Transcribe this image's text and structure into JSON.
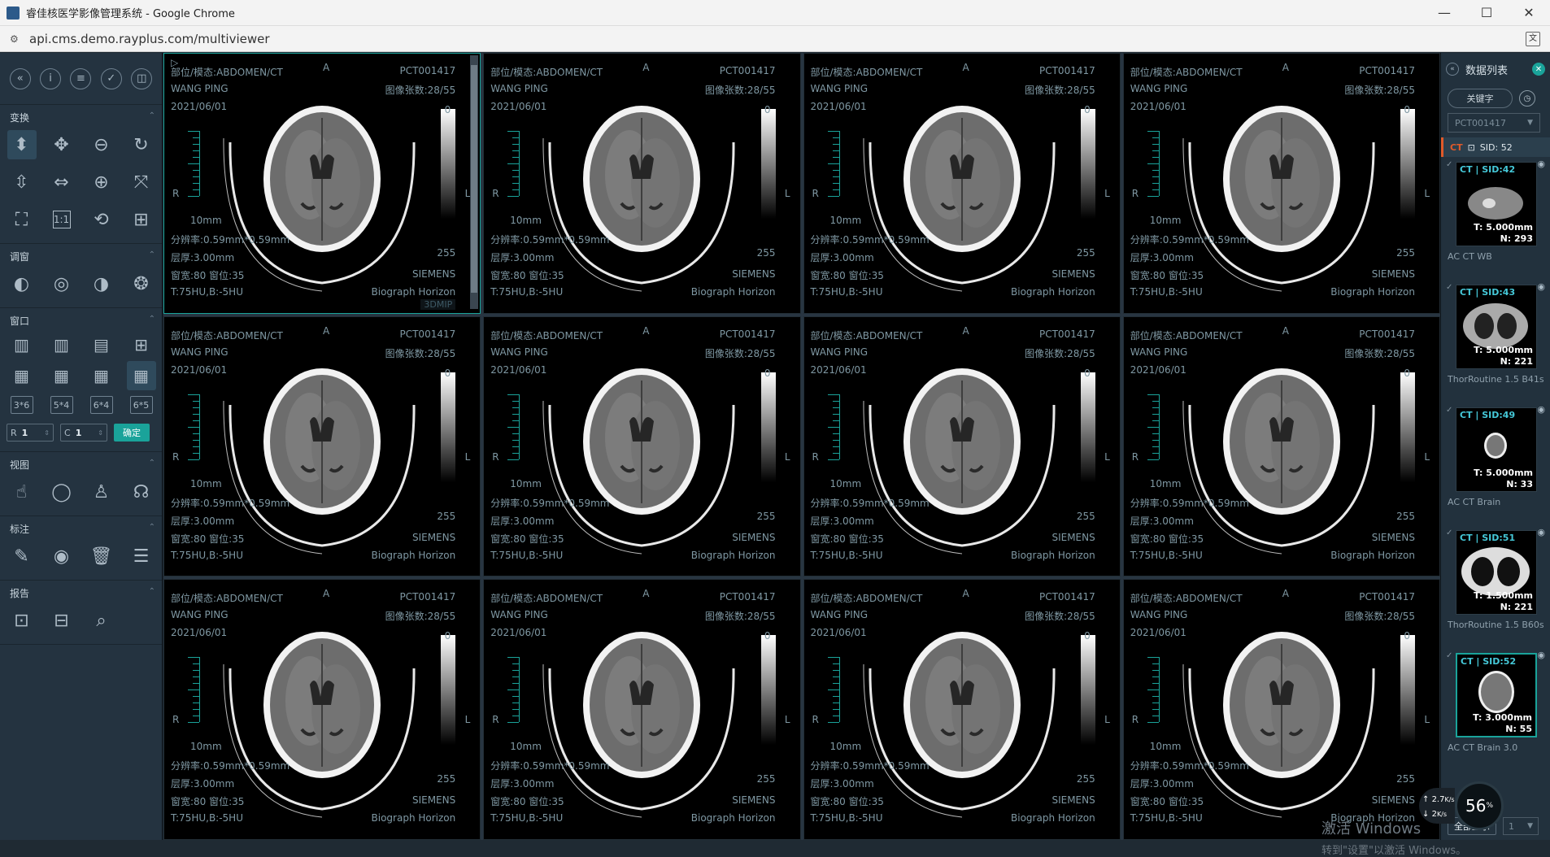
{
  "browser": {
    "title": "睿佳核医学影像管理系统 - Google Chrome",
    "url": "api.cms.demo.rayplus.com/multiviewer",
    "controls": [
      "—",
      "☐",
      "✕"
    ]
  },
  "left_panel": {
    "sections": [
      {
        "title": "变换"
      },
      {
        "title": "调窗"
      },
      {
        "title": "窗口"
      },
      {
        "title": "视图"
      },
      {
        "title": "标注"
      },
      {
        "title": "报告"
      }
    ],
    "layout_presets": [
      "3*6",
      "5*4",
      "6*4",
      "6*5"
    ],
    "row_label": "R",
    "row_value": "1",
    "col_label": "C",
    "col_value": "1",
    "confirm_label": "确定"
  },
  "viewport": {
    "body_part": "部位/模态:ABDOMEN/CT",
    "patient": "WANG PING",
    "date": "2021/06/01",
    "patient_id": "PCT001417",
    "image_count": "图像张数:28/55",
    "orient_top": "A",
    "orient_left": "R",
    "orient_right": "L",
    "scale_label": "10mm",
    "window_top": "0",
    "window_bottom": "255",
    "resolution": "分辨率:0.59mm*0.59mm",
    "thickness": "层厚:3.00mm",
    "window": "窗宽:80 窗位:35",
    "threshold": "T:75HU,B:-5HU",
    "manufacturer": "SIEMENS",
    "model": "Biograph Horizon",
    "mip_label": "3DMIP",
    "count": 12
  },
  "right_panel": {
    "title": "数据列表",
    "keyword_label": "关键字",
    "patient_select": "PCT001417",
    "current_sid_modality": "CT",
    "current_sid": "SID: 52",
    "series": [
      {
        "label": "CT | SID:42",
        "t": "T: 5.000mm",
        "n": "N: 293",
        "name": "AC CT WB"
      },
      {
        "label": "CT | SID:43",
        "t": "T: 5.000mm",
        "n": "N: 221",
        "name": "ThorRoutine 1.5 B41s"
      },
      {
        "label": "CT | SID:49",
        "t": "T: 5.000mm",
        "n": "N: 33",
        "name": "AC CT Brain"
      },
      {
        "label": "CT | SID:51",
        "t": "T: 1.500mm",
        "n": "N: 221",
        "name": "ThorRoutine 1.5 B60s"
      },
      {
        "label": "CT | SID:52",
        "t": "T: 3.000mm",
        "n": "N: 55",
        "name": "AC CT Brain 3.0"
      }
    ],
    "show_all_label": "全部显示",
    "page_value": "1"
  },
  "overlay": {
    "upload_rate": "2.7",
    "upload_unit": "K/s",
    "download_rate": "2",
    "download_unit": "K/s",
    "cpu_percent": "56",
    "watermark_line1": "激活 Windows",
    "watermark_line2": "转到\"设置\"以激活 Windows。"
  }
}
